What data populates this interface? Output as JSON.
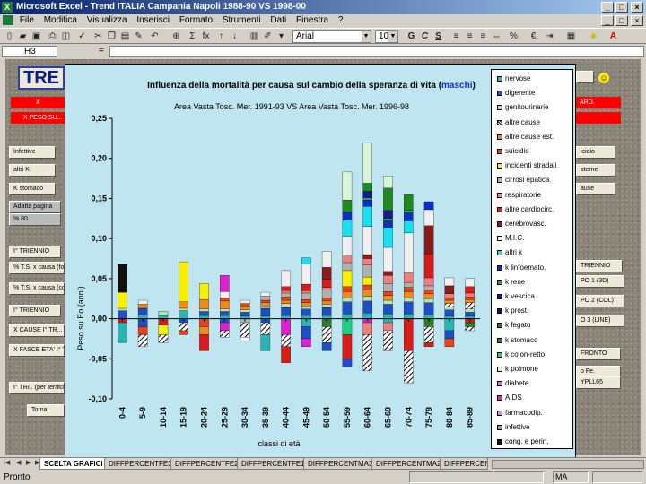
{
  "window": {
    "title": "Microsoft Excel - Trend ITALIA Campania Napoli 1988-90 VS 1998-00"
  },
  "menu": [
    "File",
    "Modifica",
    "Visualizza",
    "Inserisci",
    "Formato",
    "Strumenti",
    "Dati",
    "Finestra",
    "?"
  ],
  "toolbar": {
    "font": "Arial",
    "size": "10",
    "bold": "G",
    "italic": "C",
    "underline": "S",
    "sum": "Σ",
    "fx_label": "fx",
    "currency": "€"
  },
  "formula": {
    "cell": "H3",
    "fx": "=",
    "value": ""
  },
  "sheet": {
    "title_fragment": "TRE",
    "left_buttons": [
      "Infettive",
      "altri K",
      "K stomaco",
      "Adatta pagina",
      "% 80",
      "I° TRIENNIO",
      "% T.S. x causa (for...",
      "% T.S. x causa (co...",
      "I° TRIENNIO",
      "X CAUSE I° TR...",
      "X FASCE ETA' I° T...",
      "I° TRI.. (per territori...",
      "Torna"
    ],
    "red_bars": [
      "X",
      "X PESO SU..."
    ],
    "right_buttons": [
      "ARD.",
      "icidio",
      "sterne",
      "ause",
      "TRIENNIO",
      "PO 1 (3D)",
      "PO 2 (COL)",
      "O 3 (LINE)",
      "FRONTO",
      "o Fe.",
      "YPLL65"
    ]
  },
  "chart_data": {
    "type": "bar",
    "stacked": true,
    "title": "Influenza della mortalità per causa sul cambio della speranza di vita (",
    "title_highlight": "maschi",
    "title_end": ")",
    "subtitle": "Area Vasta Tosc. Mer. 1991-93 VS Area Vasta Tosc. Mer. 1996-98",
    "xlabel": "classi di età",
    "ylabel": "Peso su Eo (anni)",
    "ylim": [
      -0.1,
      0.25
    ],
    "yticks": [
      "0,25",
      "0,20",
      "0,15",
      "0,10",
      "0,05",
      "0,00",
      "-0,05",
      "-0,10"
    ],
    "ytick_values": [
      0.25,
      0.2,
      0.15,
      0.1,
      0.05,
      0.0,
      -0.05,
      -0.1
    ],
    "categories": [
      "0-4",
      "5-9",
      "10-14",
      "15-19",
      "20-24",
      "25-29",
      "30-34",
      "35-39",
      "40-44",
      "45-49",
      "50-54",
      "55-59",
      "60-64",
      "65-69",
      "70-74",
      "75-79",
      "80-84",
      "85-89"
    ],
    "grid": false,
    "legend_position": "right",
    "series": [
      {
        "name": "nervose",
        "color": "#2ab5b5",
        "values": [
          0.0,
          0.005,
          0.004,
          0.01,
          0.004,
          0.004,
          0.003,
          0.003,
          0.004,
          0.004,
          0.004,
          0.006,
          0.007,
          0.006,
          0.006,
          0.005,
          0.003,
          0.003
        ]
      },
      {
        "name": "digerente",
        "color": "#1f4fc8",
        "values": [
          0.01,
          0.008,
          0.0,
          0.0,
          0.005,
          0.005,
          0.005,
          0.01,
          0.01,
          0.008,
          0.01,
          0.015,
          0.015,
          0.012,
          0.015,
          0.015,
          0.008,
          0.005
        ]
      },
      {
        "name": "genitourinarie",
        "color": "#b7e3b7",
        "values": [
          0.003,
          0.0,
          0.005,
          0.003,
          0.003,
          0.003,
          0.003,
          0.003,
          0.005,
          0.004,
          0.004,
          0.005,
          0.006,
          0.005,
          0.005,
          0.005,
          0.004,
          0.004
        ]
      },
      {
        "name": "altre cause",
        "color": "#000000",
        "pattern": "hatch",
        "values": [
          0.0,
          0.0,
          0.0,
          0.0,
          0.0,
          0.0,
          0.0,
          0.0,
          0.0,
          0.0,
          0.0,
          0.0,
          0.0,
          0.0,
          0.0,
          0.0,
          0.004,
          0.008
        ]
      },
      {
        "name": "altre cause est.",
        "color": "#f08a1c",
        "values": [
          0.0,
          0.005,
          0.0,
          0.008,
          0.012,
          0.01,
          0.005,
          0.004,
          0.004,
          0.004,
          0.004,
          0.008,
          0.008,
          0.006,
          0.008,
          0.006,
          0.004,
          0.004
        ]
      },
      {
        "name": "suicidio",
        "color": "#e8431c",
        "values": [
          0.0,
          0.0,
          0.0,
          0.0,
          0.0,
          0.004,
          0.003,
          0.003,
          0.004,
          0.004,
          0.004,
          0.006,
          0.006,
          0.005,
          0.005,
          0.005,
          0.003,
          0.003
        ]
      },
      {
        "name": "incidenti stradali",
        "color": "#f8f000",
        "values": [
          0.02,
          0.0,
          0.0,
          0.05,
          0.02,
          0.0,
          0.0,
          0.0,
          0.0,
          0.0,
          0.0,
          0.02,
          0.01,
          0.0,
          0.0,
          0.0,
          0.0,
          0.0
        ]
      },
      {
        "name": "cirrosi epatica",
        "color": "#b0b0b0",
        "values": [
          0.0,
          0.0,
          0.0,
          0.0,
          0.0,
          0.0,
          0.0,
          0.005,
          0.005,
          0.008,
          0.01,
          0.01,
          0.015,
          0.01,
          0.006,
          0.005,
          0.0,
          0.0
        ]
      },
      {
        "name": "respiratorie",
        "color": "#f08080",
        "values": [
          0.0,
          0.0,
          0.0,
          0.0,
          0.0,
          0.0,
          0.0,
          0.0,
          0.003,
          0.003,
          0.003,
          0.008,
          0.008,
          0.01,
          0.012,
          0.01,
          0.005,
          0.005
        ]
      },
      {
        "name": "altre cardiocirc.",
        "color": "#d81b1b",
        "values": [
          0.0,
          0.0,
          0.0,
          0.0,
          0.0,
          0.0,
          0.0,
          0.0,
          0.005,
          0.008,
          0.01,
          0.0,
          0.0,
          0.0,
          0.0,
          0.03,
          0.0,
          0.008
        ]
      },
      {
        "name": "cerebrovasc.",
        "color": "#8b1a1a",
        "values": [
          0.0,
          0.0,
          0.0,
          0.0,
          0.0,
          0.0,
          0.0,
          0.0,
          0.0,
          0.0,
          0.015,
          0.0,
          0.005,
          0.005,
          0.0,
          0.035,
          0.01,
          0.0
        ]
      },
      {
        "name": "M.I.C.",
        "color": "#f0f0f0",
        "values": [
          0.0,
          0.005,
          0.0,
          0.0,
          0.0,
          0.008,
          0.004,
          0.005,
          0.02,
          0.025,
          0.02,
          0.025,
          0.035,
          0.03,
          0.05,
          0.02,
          0.01,
          0.01
        ]
      },
      {
        "name": "altri k",
        "color": "#18e0f0",
        "values": [
          0.0,
          0.0,
          0.0,
          0.0,
          0.0,
          0.0,
          0.0,
          0.0,
          0.0,
          0.008,
          0.0,
          0.02,
          0.025,
          0.025,
          0.015,
          0.0,
          0.0,
          0.0
        ]
      },
      {
        "name": "k linfoemato.",
        "color": "#0a30c8",
        "values": [
          0.0,
          0.0,
          0.0,
          0.0,
          0.0,
          0.0,
          0.0,
          0.0,
          0.0,
          0.0,
          0.0,
          0.01,
          0.008,
          0.008,
          0.01,
          0.01,
          0.0,
          0.0
        ]
      },
      {
        "name": "k rene",
        "color": "#3a9a6a",
        "values": [
          0.0,
          0.0,
          0.0,
          0.0,
          0.0,
          0.0,
          0.0,
          0.0,
          0.0,
          0.0,
          0.0,
          0.0,
          0.003,
          0.003,
          0.003,
          0.0,
          0.0,
          0.0
        ]
      },
      {
        "name": "k vescica",
        "color": "#1a1a90",
        "values": [
          0.0,
          0.0,
          0.0,
          0.0,
          0.0,
          0.0,
          0.0,
          0.0,
          0.0,
          0.0,
          0.0,
          0.0,
          0.008,
          0.01,
          0.0,
          0.0,
          0.0,
          0.0
        ]
      },
      {
        "name": "k prost.",
        "color": "#10106a",
        "values": [
          0.0,
          0.0,
          0.0,
          0.0,
          0.0,
          0.0,
          0.0,
          0.0,
          0.0,
          0.0,
          0.0,
          0.0,
          0.0,
          0.0,
          0.0,
          0.0,
          0.0,
          0.0
        ]
      },
      {
        "name": "k fegato",
        "color": "#2f7a22",
        "values": [
          0.0,
          0.0,
          0.0,
          0.0,
          0.0,
          0.0,
          0.0,
          0.0,
          0.0,
          0.0,
          0.0,
          0.0,
          0.0,
          0.0,
          0.0,
          0.0,
          0.0,
          0.0
        ]
      },
      {
        "name": "k stomaco",
        "color": "#1f8a1f",
        "values": [
          0.0,
          0.0,
          0.0,
          0.0,
          0.0,
          0.0,
          0.0,
          0.0,
          0.0,
          0.0,
          0.0,
          0.015,
          0.01,
          0.028,
          0.02,
          0.0,
          0.0,
          0.0
        ]
      },
      {
        "name": "k colon-retto",
        "color": "#1fd080",
        "values": [
          0.0,
          0.0,
          0.0,
          0.0,
          0.0,
          0.0,
          0.0,
          0.0,
          0.0,
          0.0,
          0.0,
          0.0,
          0.0,
          0.0,
          0.0,
          0.0,
          0.0,
          0.0
        ]
      },
      {
        "name": "k polmone",
        "color": "#d8f5d8",
        "values": [
          0.0,
          0.0,
          0.0,
          0.0,
          0.0,
          0.0,
          0.0,
          0.0,
          0.0,
          0.0,
          0.0,
          0.035,
          0.05,
          0.015,
          0.0,
          0.0,
          0.0,
          0.0
        ]
      },
      {
        "name": "diabete",
        "color": "#c878e0",
        "values": [
          0.0,
          0.0,
          0.0,
          0.0,
          0.0,
          0.0,
          0.0,
          0.0,
          0.0,
          0.0,
          0.0,
          0.0,
          0.0,
          0.0,
          0.0,
          0.0,
          0.0,
          0.0
        ]
      },
      {
        "name": "AIDS",
        "color": "#e020d0",
        "values": [
          0.0,
          0.0,
          0.0,
          0.0,
          0.0,
          0.02,
          0.0,
          0.0,
          0.0,
          0.0,
          0.0,
          0.0,
          0.0,
          0.0,
          0.0,
          0.0,
          0.0,
          0.0
        ]
      },
      {
        "name": "farmacodip.",
        "color": "#e080e8",
        "values": [
          0.0,
          0.0,
          0.0,
          0.0,
          0.0,
          0.0,
          0.0,
          0.0,
          0.0,
          0.0,
          0.0,
          0.0,
          0.0,
          0.0,
          0.0,
          0.0,
          0.0,
          0.0
        ]
      },
      {
        "name": "infettive",
        "color": "#a0a0a0",
        "values": [
          0.0,
          0.0,
          0.0,
          0.0,
          0.0,
          0.0,
          0.0,
          0.0,
          0.0,
          0.0,
          0.0,
          0.0,
          0.0,
          0.0,
          0.0,
          0.0,
          0.0,
          0.0
        ]
      },
      {
        "name": "cong. e perin.",
        "color": "#111111",
        "values": [
          0.035,
          0.0,
          0.0,
          0.0,
          0.0,
          0.0,
          0.0,
          0.0,
          0.0,
          0.0,
          0.0,
          0.0,
          0.0,
          0.0,
          0.0,
          0.0,
          0.0,
          0.0
        ]
      }
    ],
    "negatives": [
      [
        {
          "c": "#d81b1b",
          "v": -0.005
        },
        {
          "c": "#2ab5b5",
          "v": -0.025
        }
      ],
      [
        {
          "c": "#1f4fc8",
          "v": -0.01
        },
        {
          "c": "#e8431c",
          "v": -0.01
        },
        {
          "c": "#000000",
          "v": -0.015
        }
      ],
      [
        {
          "c": "#d81b1b",
          "v": -0.008
        },
        {
          "c": "#f8f000",
          "v": -0.012
        },
        {
          "c": "#000000",
          "v": -0.01
        }
      ],
      [
        {
          "c": "#1f4fc8",
          "v": -0.005
        },
        {
          "c": "#000000",
          "v": -0.01
        },
        {
          "c": "#e8431c",
          "v": -0.005
        }
      ],
      [
        {
          "c": "#e8431c",
          "v": -0.01
        },
        {
          "c": "#f08a1c",
          "v": -0.01
        },
        {
          "c": "#d81b1b",
          "v": -0.02
        }
      ],
      [
        {
          "c": "#1f4fc8",
          "v": -0.005
        },
        {
          "c": "#e020d0",
          "v": -0.01
        },
        {
          "c": "#000000",
          "v": -0.008
        }
      ],
      [
        {
          "c": "#b0b0b0",
          "v": -0.005
        },
        {
          "c": "#000000",
          "v": -0.018
        },
        {
          "c": "#ffffff",
          "v": -0.005
        }
      ],
      [
        {
          "c": "#1f4fc8",
          "v": -0.005
        },
        {
          "c": "#000000",
          "v": -0.015
        },
        {
          "c": "#2ab5b5",
          "v": -0.02
        }
      ],
      [
        {
          "c": "#e020d0",
          "v": -0.02
        },
        {
          "c": "#000000",
          "v": -0.015
        },
        {
          "c": "#d81b1b",
          "v": -0.02
        }
      ],
      [
        {
          "c": "#2ab5b5",
          "v": -0.01
        },
        {
          "c": "#1f4fc8",
          "v": -0.015
        },
        {
          "c": "#e020d0",
          "v": -0.01
        }
      ],
      [
        {
          "c": "#2f7a22",
          "v": -0.01
        },
        {
          "c": "#000000",
          "v": -0.02
        },
        {
          "c": "#1f4fc8",
          "v": -0.01
        }
      ],
      [
        {
          "c": "#1fd080",
          "v": -0.02
        },
        {
          "c": "#d81b1b",
          "v": -0.03
        },
        {
          "c": "#1f4fc8",
          "v": -0.01
        }
      ],
      [
        {
          "c": "#e020d0",
          "v": -0.005
        },
        {
          "c": "#f08080",
          "v": -0.015
        },
        {
          "c": "#000000",
          "v": -0.045
        }
      ],
      [
        {
          "c": "#2ab5b5",
          "v": -0.005
        },
        {
          "c": "#f08080",
          "v": -0.01
        },
        {
          "c": "#000000",
          "v": -0.025
        }
      ],
      [
        {
          "c": "#d81b1b",
          "v": -0.04
        },
        {
          "c": "#000000",
          "v": -0.04
        }
      ],
      [
        {
          "c": "#2f7a22",
          "v": -0.01
        },
        {
          "c": "#000000",
          "v": -0.02
        },
        {
          "c": "#d81b1b",
          "v": -0.005
        }
      ],
      [
        {
          "c": "#2ab5b5",
          "v": -0.015
        },
        {
          "c": "#1f4fc8",
          "v": -0.01
        },
        {
          "c": "#e8431c",
          "v": -0.01
        }
      ],
      [
        {
          "c": "#d81b1b",
          "v": -0.005
        },
        {
          "c": "#1f8a1f",
          "v": -0.005
        },
        {
          "c": "#000000",
          "v": -0.005
        }
      ]
    ]
  },
  "tabs": [
    "SCELTA GRAFICI",
    "DIFFPERCENTFE3",
    "DIFFPERCENTFE2",
    "DIFFPERCENTFE1",
    "DIFFPERCENTMA3",
    "DIFFPERCENTMA2",
    "DIFFPERCENT"
  ],
  "status": {
    "text": "Pronto",
    "mode": "MA"
  }
}
